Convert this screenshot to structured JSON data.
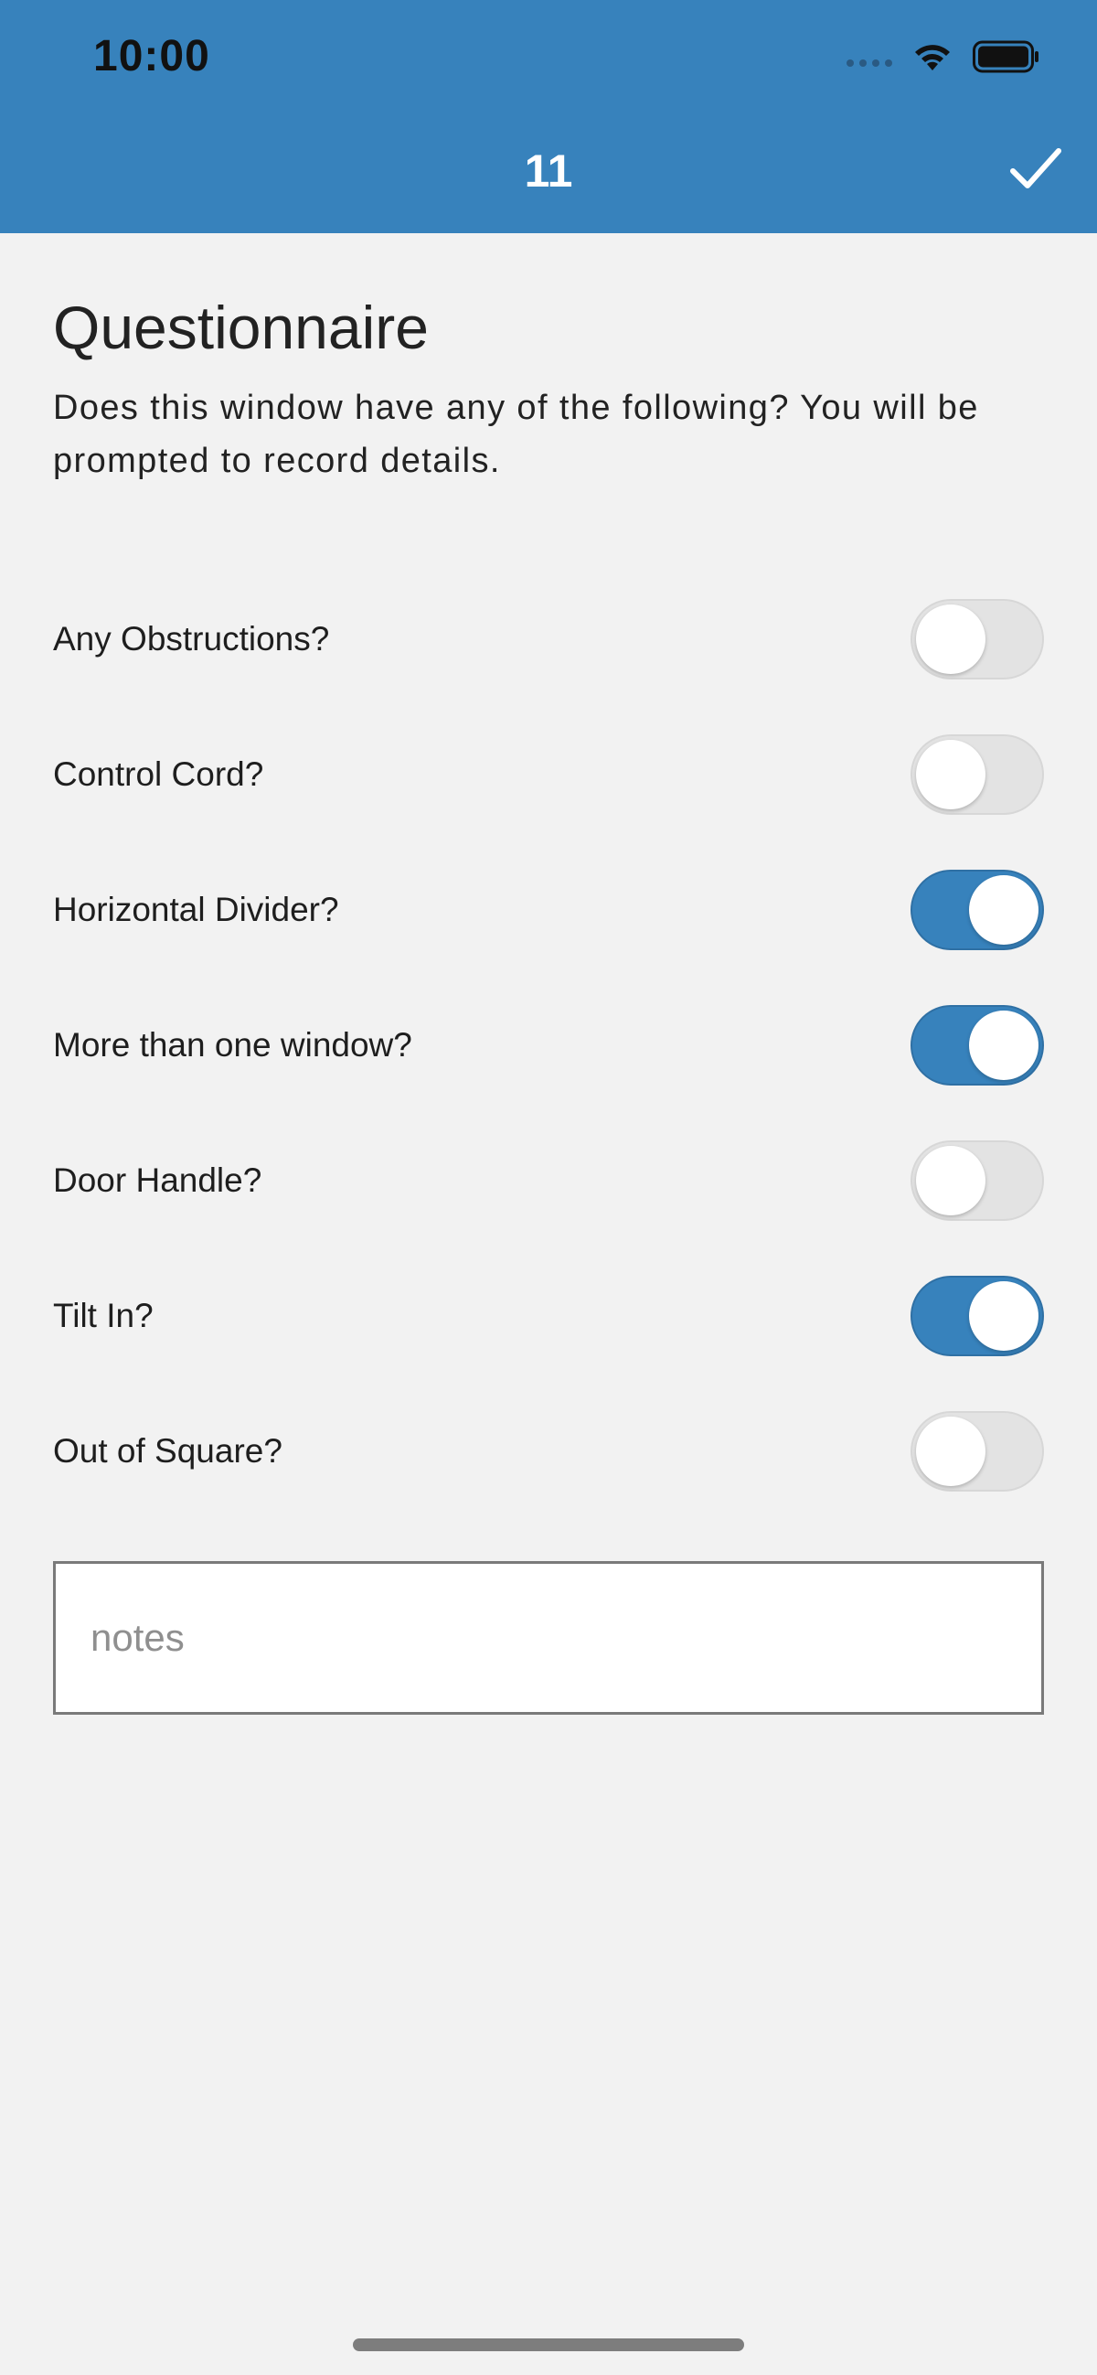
{
  "status_bar": {
    "time": "10:00",
    "icons": [
      "signal-dots-icon",
      "wifi-icon",
      "battery-icon"
    ]
  },
  "nav": {
    "title": "11",
    "confirm_icon": "checkmark-icon"
  },
  "questionnaire": {
    "title": "Questionnaire",
    "description": "Does this window have any of the following?  You will be prompted to record details.",
    "items": [
      {
        "label": "Any Obstructions?",
        "on": false
      },
      {
        "label": "Control Cord?",
        "on": false
      },
      {
        "label": "Horizontal Divider?",
        "on": true
      },
      {
        "label": "More than one window?",
        "on": true
      },
      {
        "label": "Door Handle?",
        "on": false
      },
      {
        "label": "Tilt In?",
        "on": true
      },
      {
        "label": "Out of Square?",
        "on": false
      }
    ]
  },
  "notes": {
    "placeholder": "notes",
    "value": ""
  },
  "colors": {
    "accent": "#3782bc",
    "background": "#f2f2f2",
    "toggle_off": "#e3e3e3"
  }
}
